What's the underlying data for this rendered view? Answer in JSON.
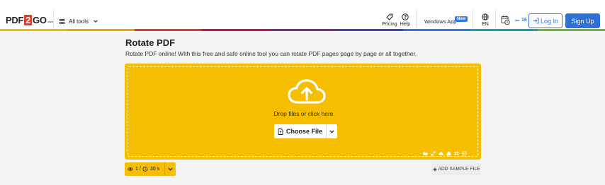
{
  "header": {
    "logo": {
      "pdf": "PDF",
      "two": "2",
      "go": "GO",
      "com": ".com"
    },
    "all_tools_label": "All tools",
    "pricing_label": "Pricing",
    "help_label": "Help",
    "windows_app_label": "Windows App",
    "new_badge": "New",
    "language_label": "EN",
    "counter_value": "16",
    "login_label": "Log In",
    "signup_label": "Sign Up"
  },
  "main": {
    "title": "Rotate PDF",
    "subtitle": "Rotate PDF online! With this free and safe online tool you can rotate PDF pages page by page or all together.",
    "drop_text": "Drop files or click here",
    "choose_file_label": "Choose File",
    "upload_sources": [
      "folder-icon",
      "link-icon",
      "cloud-upload-icon",
      "google-drive-icon",
      "dropbox-icon",
      "onedrive-icon"
    ]
  },
  "limits": {
    "files": "1",
    "separator": "/",
    "time": "30 s"
  },
  "sample_label": "ADD SAMPLE FILE",
  "colors": {
    "accent_blue": "#2f6fd8",
    "dropzone_yellow": "#f6be00",
    "rainbow": [
      "#f6be00",
      "#e8a900",
      "#e03c2e",
      "#c0135a",
      "#8a2a8c",
      "#3f4aa6",
      "#2f7be0",
      "#1aa0a8",
      "#6bb43a"
    ]
  }
}
